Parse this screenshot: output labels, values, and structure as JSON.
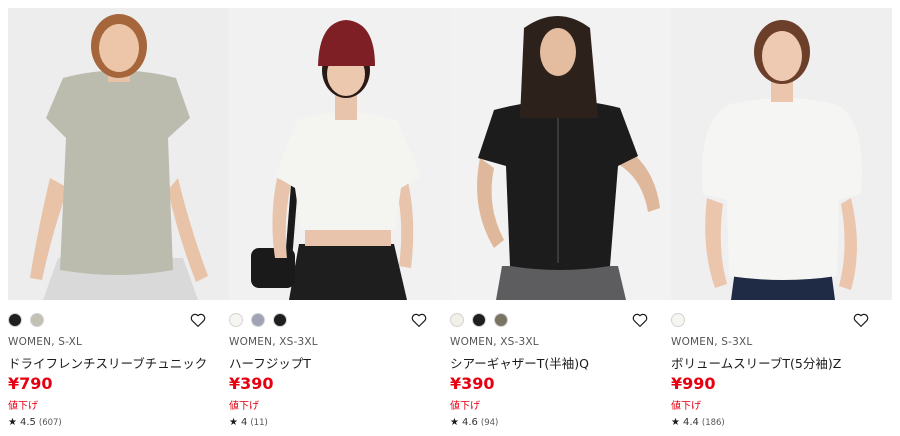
{
  "products": [
    {
      "swatches": [
        {
          "color": "#1f1f1f",
          "name": "black"
        },
        {
          "color": "#c2c1b3",
          "name": "sage"
        }
      ],
      "meta": "WOMEN, S-XL",
      "name": "ドライフレンチスリーブチュニック",
      "price": "¥790",
      "badge": "値下げ",
      "rating": "4.5",
      "reviews": "(607)",
      "garment_color": "#bcbcae"
    },
    {
      "swatches": [
        {
          "color": "#f6f5f1",
          "name": "white"
        },
        {
          "color": "#9fa3b3",
          "name": "gray"
        },
        {
          "color": "#1f1f1f",
          "name": "black"
        }
      ],
      "meta": "WOMEN, XS-3XL",
      "name": "ハーフジップT",
      "price": "¥390",
      "badge": "値下げ",
      "rating": "4",
      "reviews": "(11)",
      "garment_color": "#f4f4f1"
    },
    {
      "swatches": [
        {
          "color": "#f3f0e9",
          "name": "ivory"
        },
        {
          "color": "#1f1f1f",
          "name": "black"
        },
        {
          "color": "#7a7462",
          "name": "olive"
        }
      ],
      "meta": "WOMEN, XS-3XL",
      "name": "シアーギャザーT(半袖)Q",
      "price": "¥390",
      "badge": "値下げ",
      "rating": "4.6",
      "reviews": "(94)",
      "garment_color": "#1c1c1c"
    },
    {
      "swatches": [
        {
          "color": "#f6f5f1",
          "name": "white"
        }
      ],
      "meta": "WOMEN, S-3XL",
      "name": "ボリュームスリーブT(5分袖)Z",
      "price": "¥990",
      "badge": "値下げ",
      "rating": "4.4",
      "reviews": "(186)",
      "garment_color": "#f5f5f3"
    }
  ],
  "icons": {
    "favorite": "heart-outline-icon",
    "rating": "star-icon"
  }
}
